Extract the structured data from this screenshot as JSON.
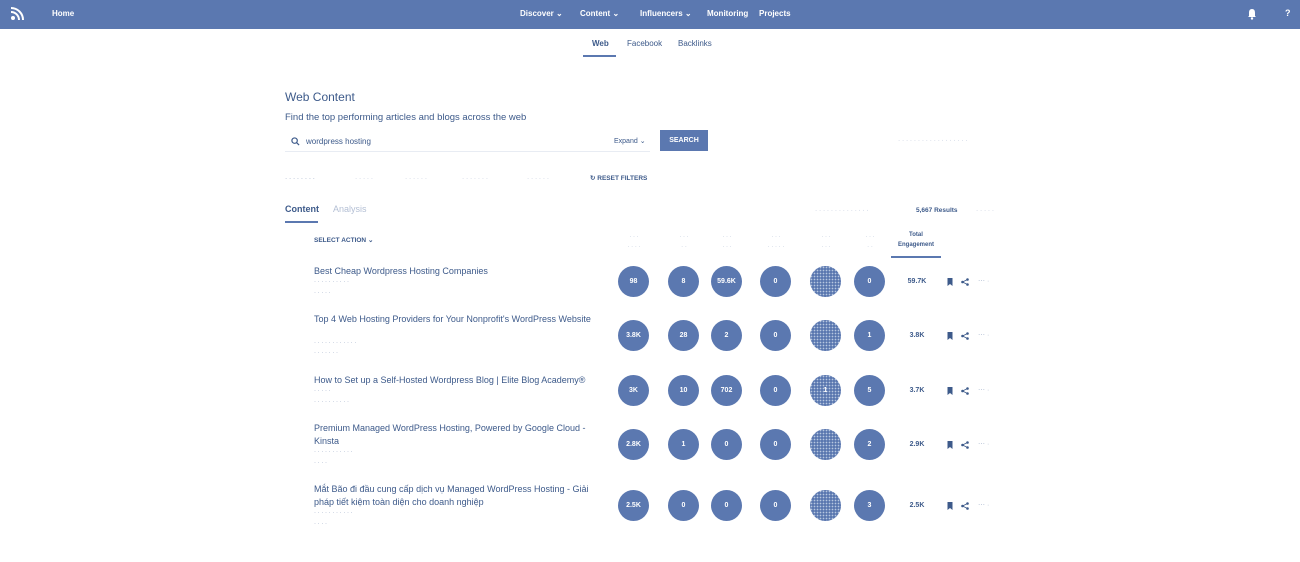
{
  "topbar": {
    "home": "Home",
    "nav": [
      {
        "label": "Discover",
        "has_dropdown": true
      },
      {
        "label": "Content",
        "has_dropdown": true
      },
      {
        "label": "Influencers",
        "has_dropdown": true
      },
      {
        "label": "Monitoring",
        "has_dropdown": false
      },
      {
        "label": "Projects",
        "has_dropdown": false
      }
    ],
    "help": "?",
    "icons": [
      "rss-logo-icon",
      "bell-icon"
    ]
  },
  "subtabs": [
    "Web",
    "Facebook",
    "Backlinks"
  ],
  "page": {
    "title": "Web Content",
    "subtitle": "Find the top performing articles and blogs across the web"
  },
  "search": {
    "value": "wordpress hosting",
    "expand": "Expand",
    "button": "SEARCH"
  },
  "filters": {
    "reset": "RESET FILTERS"
  },
  "content_tabs": [
    "Content",
    "Analysis"
  ],
  "results_count": "5,667 Results",
  "select_action": "SELECT ACTION",
  "column_header_total": "Total Engagement",
  "colors": {
    "accent": "#5b78b0",
    "text": "#3d5a8a",
    "faint": "#b3bfd4"
  },
  "rows": [
    {
      "title": "Best Cheap Wordpress Hosting Companies",
      "values": [
        "98",
        "8",
        "59.6K",
        "0",
        "",
        "0"
      ],
      "total": "59.7K"
    },
    {
      "title": "Top 4 Web Hosting Providers for Your Nonprofit's WordPress Website",
      "values": [
        "3.8K",
        "28",
        "2",
        "0",
        "",
        "1"
      ],
      "total": "3.8K"
    },
    {
      "title": "How to Set up a Self-Hosted Wordpress Blog | Elite Blog Academy®",
      "values": [
        "3K",
        "10",
        "702",
        "0",
        "1",
        "5"
      ],
      "total": "3.7K"
    },
    {
      "title": "Premium Managed WordPress Hosting, Powered by Google Cloud - Kinsta",
      "values": [
        "2.8K",
        "1",
        "0",
        "0",
        "",
        "2"
      ],
      "total": "2.9K"
    },
    {
      "title": "Mắt Bão đi đầu cung cấp dịch vụ Managed WordPress Hosting - Giải pháp tiết kiệm toàn diện cho doanh nghiệp",
      "values": [
        "2.5K",
        "0",
        "0",
        "0",
        "",
        "3"
      ],
      "total": "2.5K"
    }
  ]
}
